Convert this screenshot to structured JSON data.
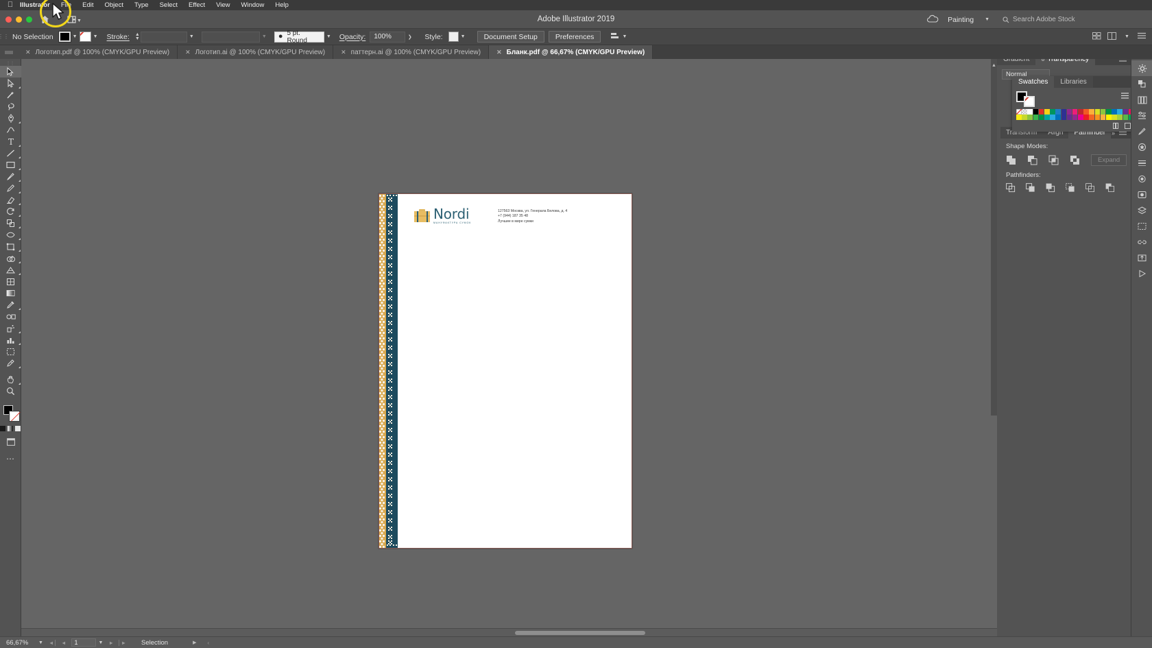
{
  "mac_menu": {
    "apple": "apple-logo",
    "items": [
      "Illustrator",
      "File",
      "Edit",
      "Object",
      "Type",
      "Select",
      "Effect",
      "View",
      "Window",
      "Help"
    ]
  },
  "titlebar": {
    "title": "Adobe Illustrator 2019",
    "home_icon": "home-icon",
    "arrange_icon": "arrange-documents-icon",
    "cloud_icon": "cloud-sync-icon",
    "workspace": "Painting",
    "search_placeholder": "Search Adobe Stock",
    "search_icon": "search-icon"
  },
  "control_bar": {
    "selection_status": "No Selection",
    "fill_color": "#000000",
    "stroke_color": "none",
    "stroke_label": "Stroke:",
    "stroke_weight": "",
    "brush_definition": "5 pt. Round",
    "opacity_label": "Opacity:",
    "opacity_value": "100%",
    "style_label": "Style:",
    "document_setup": "Document Setup",
    "preferences": "Preferences",
    "align_icon": "align-icon"
  },
  "tabs": [
    {
      "label": "Логотип.pdf @ 100% (CMYK/GPU Preview)",
      "active": false
    },
    {
      "label": "Логотип.ai @ 100% (CMYK/GPU Preview)",
      "active": false
    },
    {
      "label": "паттерн.ai @ 100% (CMYK/GPU Preview)",
      "active": false
    },
    {
      "label": "Бланк.pdf @ 66,67% (CMYK/GPU Preview)",
      "active": true
    }
  ],
  "toolbar": {
    "tools": [
      "selection-tool",
      "direct-selection-tool",
      "magic-wand-tool",
      "lasso-tool",
      "pen-tool",
      "curvature-tool",
      "type-tool",
      "line-segment-tool",
      "rectangle-tool",
      "ellipse-tool",
      "paintbrush-tool",
      "pencil-tool",
      "shaper-tool",
      "eraser-tool",
      "rotate-tool",
      "scale-tool",
      "width-tool",
      "free-transform-tool",
      "shape-builder-tool",
      "perspective-grid-tool",
      "mesh-tool",
      "gradient-tool",
      "eyedropper-tool",
      "blend-tool",
      "symbol-sprayer-tool",
      "column-graph-tool",
      "artboard-tool",
      "slice-tool",
      "hand-tool",
      "zoom-tool",
      "edit-toolbar-button"
    ],
    "fill_color": "#000000",
    "stroke_color": "none",
    "more_tools": "edit-toolbar-icon"
  },
  "artboard": {
    "logo": {
      "name": "Nordi",
      "tagline": "мануфактура сумок",
      "bag_body_color": "#e8bd62",
      "bag_strap_color": "#2c5f72",
      "text_color": "#2c6073"
    },
    "contact": [
      "127563 Москва, ул. Генерала Белова, д. 4",
      "+7 (944) 187 35 48",
      "Лучшие в мире сумки"
    ],
    "ornament_colors": {
      "gold": "#d9a94f",
      "teal": "#1d4b5e",
      "cream": "#f3ece0"
    },
    "paper_color": "#ffffff",
    "outline_color": "#8a5a52"
  },
  "right_dock": {
    "rail_icons": [
      "settings-gear-icon",
      "color-icon",
      "color-guide-icon",
      "libraries-icon",
      "properties-icon",
      "brushes-icon",
      "symbols-icon",
      "stroke-icon",
      "appearance-icon",
      "graphic-styles-icon",
      "layers-icon",
      "artboards-icon",
      "links-icon",
      "asset-export-icon",
      "actions-icon"
    ],
    "panel_top": {
      "tabs": [
        "Gradient",
        "Transparency"
      ],
      "active_tab": "Transparency",
      "blend_mode": "Normal",
      "menu_icon": "panel-menu-icon"
    },
    "swatches_panel": {
      "tabs": [
        "Swatches",
        "Libraries"
      ],
      "active_tab": "Swatches",
      "fill_color": "#000000",
      "stroke_color": "none",
      "list_view_icon": "list-view-icon",
      "grid_view_icon": "grid-view-icon",
      "menu_icon": "panel-menu-icon",
      "swatch_rows": [
        [
          "none",
          "registration",
          "#ffffff",
          "#000000",
          "#e03127",
          "#f6d117",
          "#00955e",
          "#1e7dc4",
          "#2e3192",
          "#92278f",
          "#ed1e79",
          "#c1272d",
          "#f15a24",
          "#fbb03b",
          "#d9e021",
          "#8cc63f",
          "#009245",
          "#0071bc",
          "#29abe2",
          "#662d91",
          "#ed145b",
          "#ff7bac"
        ],
        [
          "#f7ec13",
          "#c7d92d",
          "#8dc63f",
          "#39b54a",
          "#009444",
          "#00a79d",
          "#29abe2",
          "#0071bc",
          "#2e3192",
          "#662d91",
          "#92278f",
          "#ec008c",
          "#ed1c24",
          "#f26522",
          "#f7941e",
          "#fbb040",
          "#fff200",
          "#d7df23",
          "#a6ce39",
          "#57b947",
          "#00a651",
          "#00aeef"
        ]
      ]
    },
    "pathfinder_panel": {
      "tabs": [
        "Transform",
        "Align",
        "Pathfinder"
      ],
      "active_tab": "Pathfinder",
      "shape_modes_label": "Shape Modes:",
      "pathfinders_label": "Pathfinders:",
      "expand_button": "Expand",
      "shape_mode_buttons": [
        "unite-icon",
        "minus-front-icon",
        "intersect-icon",
        "exclude-icon"
      ],
      "pathfinder_buttons": [
        "divide-icon",
        "trim-icon",
        "merge-icon",
        "crop-icon",
        "outline-icon",
        "minus-back-icon"
      ],
      "trash_icon": "delete-icon",
      "menu_icon": "panel-menu-icon"
    }
  },
  "status_bar": {
    "zoom": "66,67%",
    "page_value": "1",
    "tool_status": "Selection",
    "first_icon": "first-page-icon",
    "prev_icon": "previous-page-icon",
    "next_icon": "next-page-icon",
    "last_icon": "last-page-icon"
  }
}
